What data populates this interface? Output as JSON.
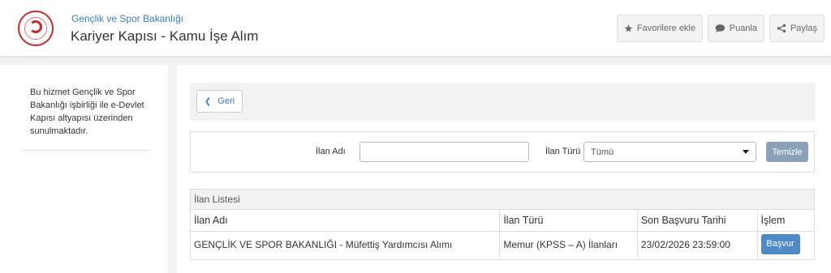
{
  "header": {
    "org_name": "Gençlik ve Spor Bakanlığı",
    "service_title": "Kariyer Kapısı - Kamu İşe Alım",
    "logo_icon": "ministry-logo-icon",
    "buttons": {
      "favorite": {
        "label": "Favorilere ekle",
        "icon": "star-icon"
      },
      "rate": {
        "label": "Puanla",
        "icon": "speech-bubble-icon"
      },
      "share": {
        "label": "Paylaş",
        "icon": "share-icon"
      }
    }
  },
  "sidebar": {
    "info_text": "Bu hizmet Gençlik ve Spor Bakanlığı işbirliği ile e-Devlet Kapısı altyapısı üzerinden sunulmaktadır."
  },
  "main": {
    "back_label": "Geri",
    "filter": {
      "name_label": "İlan Adı",
      "name_value": "",
      "type_label": "İlan Türü",
      "type_selected": "Tümü",
      "clear_label": "Temizle"
    },
    "list": {
      "title": "İlan Listesi",
      "columns": [
        "İlan Adı",
        "İlan Türü",
        "Son Başvuru Tarihi",
        "İşlem"
      ],
      "rows": [
        {
          "name": "GENÇLİK VE SPOR BAKANLIĞI - Müfettiş Yardımcısı Alımı",
          "type": "Memur (KPSS – A) İlanları",
          "deadline": "23/02/2026 23:59:00",
          "action": "Başvur"
        }
      ]
    }
  },
  "colors": {
    "link_blue": "#3b7cc0",
    "apply_button": "#4d8ac6",
    "clear_button": "#8aa1b8",
    "logo_red": "#c62b2b"
  }
}
